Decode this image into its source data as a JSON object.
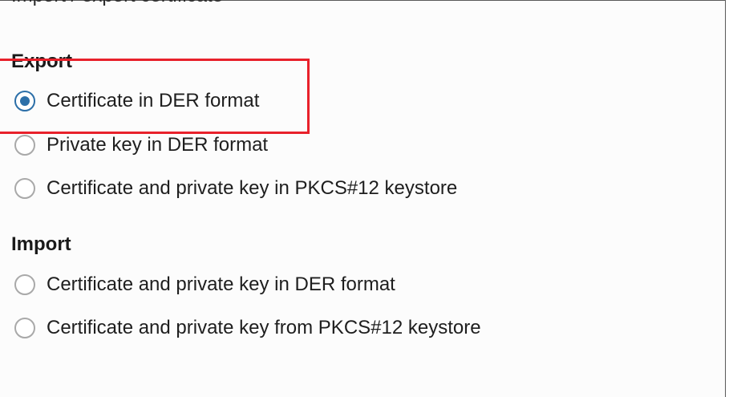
{
  "top_partial_text": "Import / export certificate",
  "export": {
    "title": "Export",
    "options": [
      {
        "label": "Certificate in DER format",
        "selected": true
      },
      {
        "label": "Private key in DER format",
        "selected": false
      },
      {
        "label": "Certificate and private key in PKCS#12 keystore",
        "selected": false
      }
    ]
  },
  "import": {
    "title": "Import",
    "options": [
      {
        "label": "Certificate and private key in DER format",
        "selected": false
      },
      {
        "label": "Certificate and private key from PKCS#12 keystore",
        "selected": false
      }
    ]
  },
  "colors": {
    "accent": "#2c6fa8",
    "annotation": "#e8212b"
  }
}
